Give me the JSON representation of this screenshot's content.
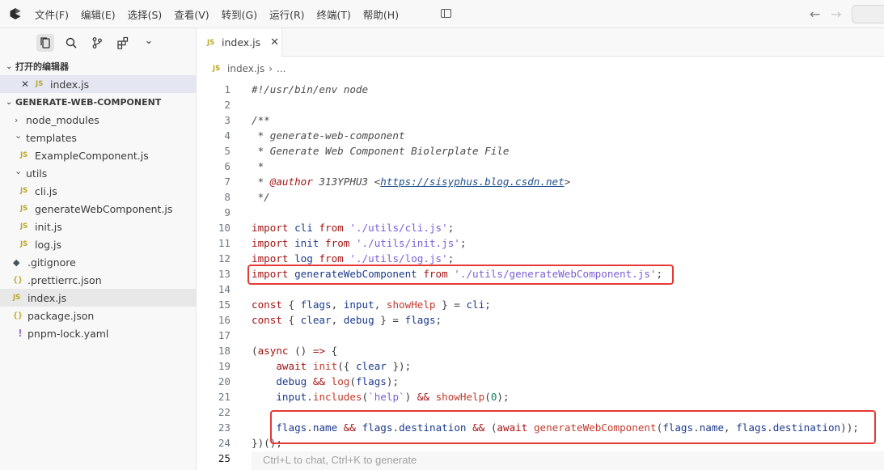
{
  "menu": [
    "文件(F)",
    "编辑(E)",
    "选择(S)",
    "查看(V)",
    "转到(G)",
    "运行(R)",
    "终端(T)",
    "帮助(H)"
  ],
  "sidebar": {
    "open_editors_title": "打开的编辑器",
    "open_editor_file": "index.js",
    "project_title": "GENERATE-WEB-COMPONENT",
    "tree": [
      {
        "label": "node_modules"
      },
      {
        "label": "templates"
      },
      {
        "label": "ExampleComponent.js"
      },
      {
        "label": "utils"
      },
      {
        "label": "cli.js"
      },
      {
        "label": "generateWebComponent.js"
      },
      {
        "label": "init.js"
      },
      {
        "label": "log.js"
      },
      {
        "label": ".gitignore"
      },
      {
        "label": ".prettierrc.json"
      },
      {
        "label": "index.js"
      },
      {
        "label": "package.json"
      },
      {
        "label": "pnpm-lock.yaml"
      }
    ]
  },
  "icons": {
    "js": "JS",
    "json": "{}",
    "yaml": "!",
    "git": "◆",
    "close": "✕",
    "chevron_right": "›",
    "chevron_down": "⌄",
    "back": "←",
    "forward": "→"
  },
  "editor": {
    "tab_label": "index.js",
    "breadcrumb_file": "index.js",
    "breadcrumb_rest": "...",
    "line_numbers": [
      "1",
      "2",
      "3",
      "4",
      "5",
      "6",
      "7",
      "8",
      "9",
      "10",
      "11",
      "12",
      "13",
      "14",
      "15",
      "16",
      "17",
      "18",
      "19",
      "20",
      "21",
      "22",
      "23",
      "24",
      "25"
    ],
    "hint": "Ctrl+L to chat, Ctrl+K to generate"
  },
  "colors": {
    "highlight_box": "#e53935",
    "js_icon": "#b8a82a"
  }
}
